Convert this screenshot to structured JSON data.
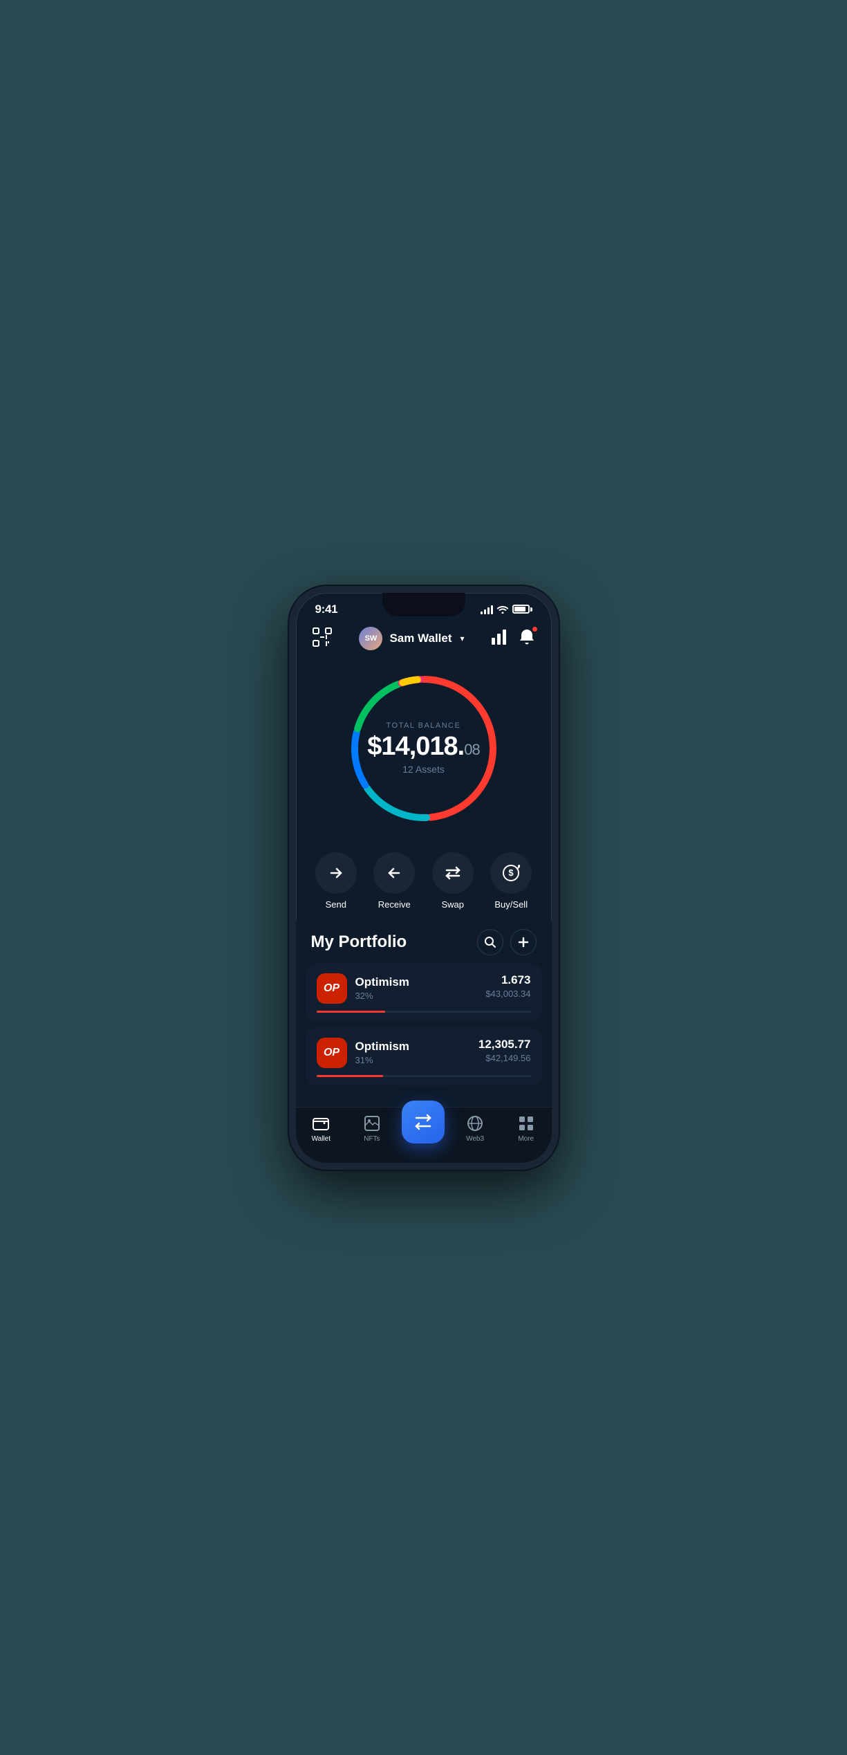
{
  "statusBar": {
    "time": "9:41",
    "batteryLevel": 85
  },
  "header": {
    "scanLabel": "scan",
    "avatarText": "SW",
    "accountName": "Sam Wallet",
    "chartLabel": "chart",
    "notificationLabel": "notifications"
  },
  "balance": {
    "label": "TOTAL BALANCE",
    "whole": "$14,018.",
    "cents": "08",
    "assetsCount": "12 Assets"
  },
  "actions": [
    {
      "id": "send",
      "label": "Send",
      "icon": "→"
    },
    {
      "id": "receive",
      "label": "Receive",
      "icon": "←"
    },
    {
      "id": "swap",
      "label": "Swap",
      "icon": "⇅"
    },
    {
      "id": "buysell",
      "label": "Buy/Sell",
      "icon": "$"
    }
  ],
  "portfolio": {
    "title": "My Portfolio",
    "searchLabel": "search",
    "addLabel": "add",
    "items": [
      {
        "id": "op1",
        "logo": "OP",
        "name": "Optimism",
        "percent": "32%",
        "amount": "1.673",
        "value": "$43,003.34",
        "progress": 32,
        "progressColor": "#ff3b30"
      },
      {
        "id": "op2",
        "logo": "OP",
        "name": "Optimism",
        "percent": "31%",
        "amount": "12,305.77",
        "value": "$42,149.56",
        "progress": 31,
        "progressColor": "#ff3b30"
      }
    ]
  },
  "bottomNav": {
    "items": [
      {
        "id": "wallet",
        "label": "Wallet",
        "icon": "💳",
        "active": true
      },
      {
        "id": "nfts",
        "label": "NFTs",
        "icon": "🖼",
        "active": false
      },
      {
        "id": "web3",
        "label": "Web3",
        "icon": "🌐",
        "active": false
      },
      {
        "id": "more",
        "label": "More",
        "icon": "⋮⋮",
        "active": false
      }
    ],
    "fabLabel": "swap"
  },
  "donut": {
    "segments": [
      {
        "color": "#ff3b30",
        "startAngle": 0,
        "endAngle": 200
      },
      {
        "color": "#ff2d55",
        "startAngle": 200,
        "endAngle": 240
      },
      {
        "color": "#ffcc00",
        "startAngle": 240,
        "endAngle": 270
      },
      {
        "color": "#34c759",
        "startAngle": 270,
        "endAngle": 340
      },
      {
        "color": "#00c7be",
        "startAngle": 340,
        "endAngle": 390
      },
      {
        "color": "#007aff",
        "startAngle": 390,
        "endAngle": 480
      },
      {
        "color": "#5856d6",
        "startAngle": 480,
        "endAngle": 510
      }
    ]
  }
}
